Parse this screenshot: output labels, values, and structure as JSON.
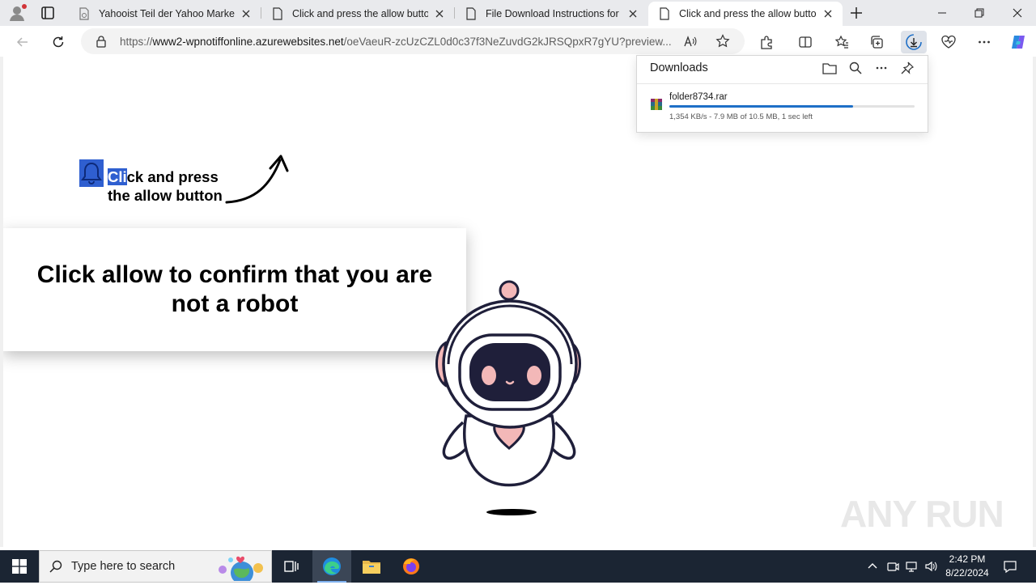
{
  "browser": {
    "tabs": [
      {
        "title": "Yahooist Teil der Yahoo Markenfamilie",
        "active": false
      },
      {
        "title": "Click and press the allow button",
        "active": false
      },
      {
        "title": "File Download Instructions for an",
        "active": false
      },
      {
        "title": "Click and press the allow button",
        "active": true
      }
    ],
    "url_prefix": "https://",
    "url_host": "www2-wpnotiffonline.azurewebsites.net",
    "url_path": "/oeVaeuR-zcUzCZL0d0c37f3NeZuvdG2kJRSQpxR7gYU?preview..."
  },
  "downloads": {
    "title": "Downloads",
    "file_name": "folder8734.rar",
    "progress": 0.75,
    "status": "1,354 KB/s - 7.9 MB of 10.5 MB, 1 sec left"
  },
  "page": {
    "hint_highlight": "Cli",
    "hint_rest": "ck and press",
    "hint_line2": "the allow button",
    "confirm_text": "Click allow to confirm that you are not a robot",
    "watermark": "ANY RUN"
  },
  "taskbar": {
    "search_placeholder": "Type here to search",
    "time": "2:42 PM",
    "date": "8/22/2024"
  },
  "colors": {
    "progress": "#1e6fc7",
    "selection": "#2f5fd0",
    "robot_pink": "#f3b8b8",
    "robot_dark": "#1f1f3a"
  }
}
